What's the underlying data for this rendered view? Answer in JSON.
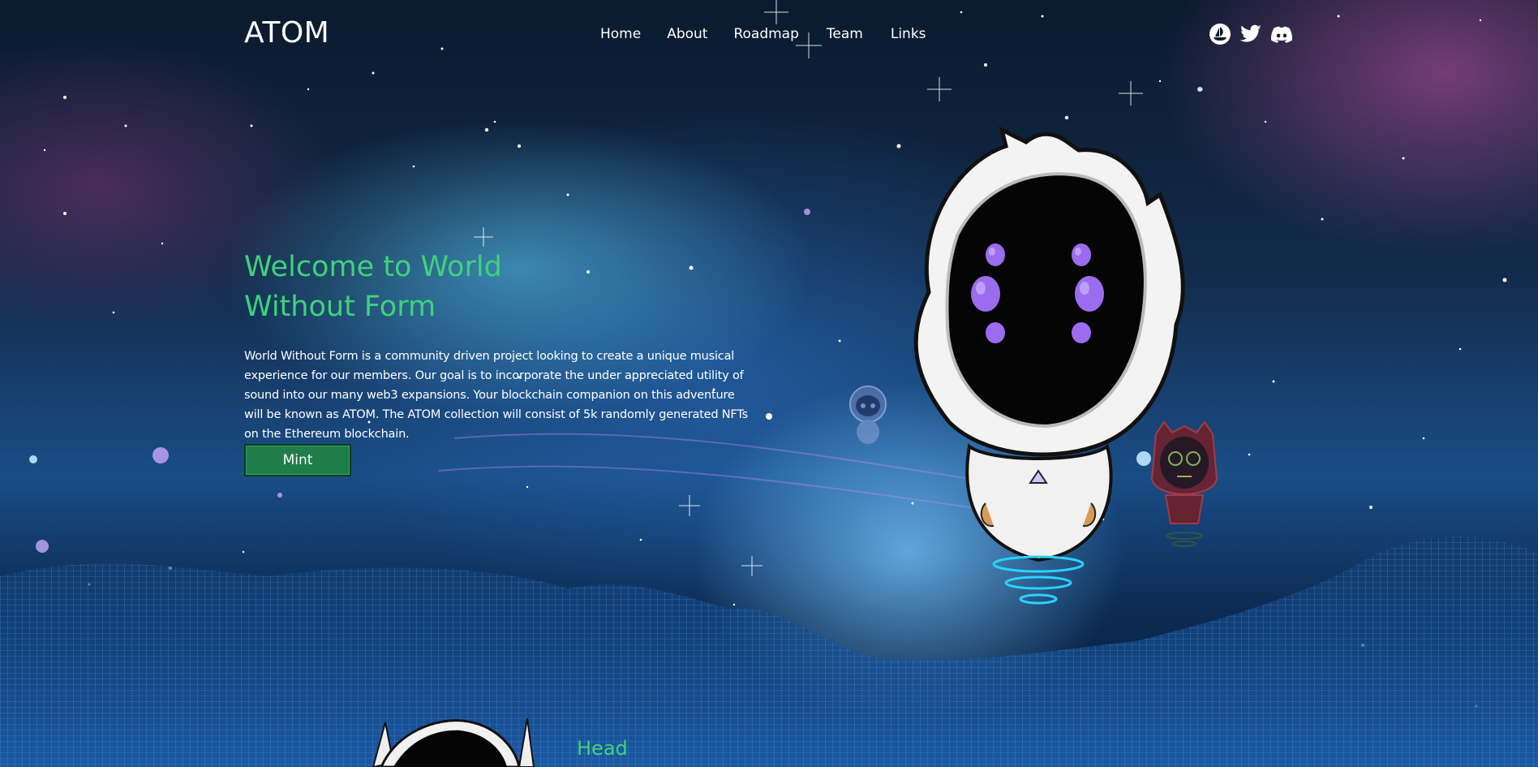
{
  "header": {
    "logo": "ATOM",
    "nav": [
      {
        "label": "Home"
      },
      {
        "label": "About"
      },
      {
        "label": "Roadmap"
      },
      {
        "label": "Team"
      },
      {
        "label": "Links"
      }
    ],
    "socials": [
      {
        "icon": "opensea-icon"
      },
      {
        "icon": "twitter-icon"
      },
      {
        "icon": "discord-icon"
      }
    ]
  },
  "hero": {
    "title": "Welcome to World Without Form",
    "description": "World Without Form is a community driven project looking to create a unique musical experience for our members. Our goal is to incorporate the under appreciated utility of sound into our many web3 expansions. Your blockchain companion on this adventure will be known as ATOM. The ATOM collection will consist of 5k randomly generated NFTs on the Ethereum blockchain.",
    "mint_label": "Mint"
  },
  "next_section": {
    "heading": "Head"
  },
  "colors": {
    "accent_green": "#3ed37a",
    "button_green": "#1f7d4a",
    "text": "#ffffff",
    "eye_purple": "#9b6cf0"
  }
}
